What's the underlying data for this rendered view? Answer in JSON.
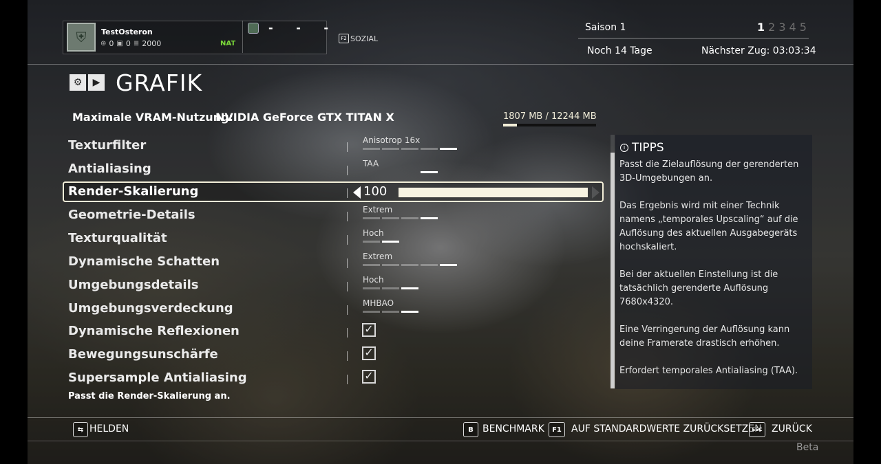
{
  "player": {
    "name": "TestOsteron",
    "stat1": "0",
    "stat2": "0",
    "currency": "2000",
    "faction": "NAT",
    "placeholder_dashes": "- - -"
  },
  "social": {
    "key": "F2",
    "label": "SOZIAL"
  },
  "season": {
    "title": "Saison 1",
    "pages": [
      "1",
      "2",
      "3",
      "4",
      "5"
    ],
    "active_page": "1",
    "remaining": "Noch 14 Tage",
    "next_move": "Nächster Zug: 03:03:34"
  },
  "page_title": "GRAFIK",
  "vram": {
    "label": "Maximale VRAM-Nutzung:",
    "gpu": "NVIDIA GeForce GTX TITAN X",
    "usage_text": "1807 MB / 12244 MB",
    "usage_fraction": 0.1476
  },
  "settings": [
    {
      "label": "Texturfilter",
      "value": "Anisotrop 16x",
      "level": 5,
      "levels": 5
    },
    {
      "label": "Antialiasing",
      "value": "TAA",
      "level": 4,
      "levels": 4,
      "hidden_before": 3
    },
    {
      "label": "Render-Skalierung",
      "value": "100",
      "selected": true
    },
    {
      "label": "Geometrie-Details",
      "value": "Extrem",
      "level": 4,
      "levels": 4
    },
    {
      "label": "Texturqualität",
      "value": "Hoch",
      "level": 3,
      "levels": 3
    },
    {
      "label": "Dynamische Schatten",
      "value": "Extrem",
      "level": 5,
      "levels": 5
    },
    {
      "label": "Umgebungsdetails",
      "value": "Hoch",
      "level": 3,
      "levels": 3
    },
    {
      "label": "Umgebungsverdeckung",
      "value": "MHBAO",
      "level": 3,
      "levels": 3
    },
    {
      "label": "Dynamische Reflexionen",
      "checked": true
    },
    {
      "label": "Bewegungsunschärfe",
      "checked": true
    },
    {
      "label": "Supersample Antialiasing",
      "checked": true
    }
  ],
  "description": "Passt die Render-Skalierung an.",
  "tips": {
    "title": "TIPPS",
    "paragraphs": [
      "Passt die Zielauflösung der gerenderten 3D-Umgebungen an.",
      "Das Ergebnis wird mit einer Technik namens „temporales Upscaling“ auf die Auflösung des aktuellen Ausgabegeräts hochskaliert.",
      "Bei der aktuellen Einstellung ist die tatsächlich gerenderte Auflösung 7680x4320.",
      "Eine Verringerung der Auflösung kann deine Framerate drastisch erhöhen.",
      "Erfordert temporales Antialiasing (TAA)."
    ]
  },
  "footer": {
    "heroes_label": "HELDEN",
    "benchmark_key": "B",
    "benchmark_label": "BENCHMARK",
    "reset_key": "F1",
    "reset_label": "AUF STANDARDWERTE ZURÜCKSETZEN",
    "back_key": "ESC",
    "back_label": "ZURÜCK",
    "beta": "Beta"
  },
  "colors": {
    "accent": "#f3efd9",
    "faction": "#7bd83a"
  }
}
